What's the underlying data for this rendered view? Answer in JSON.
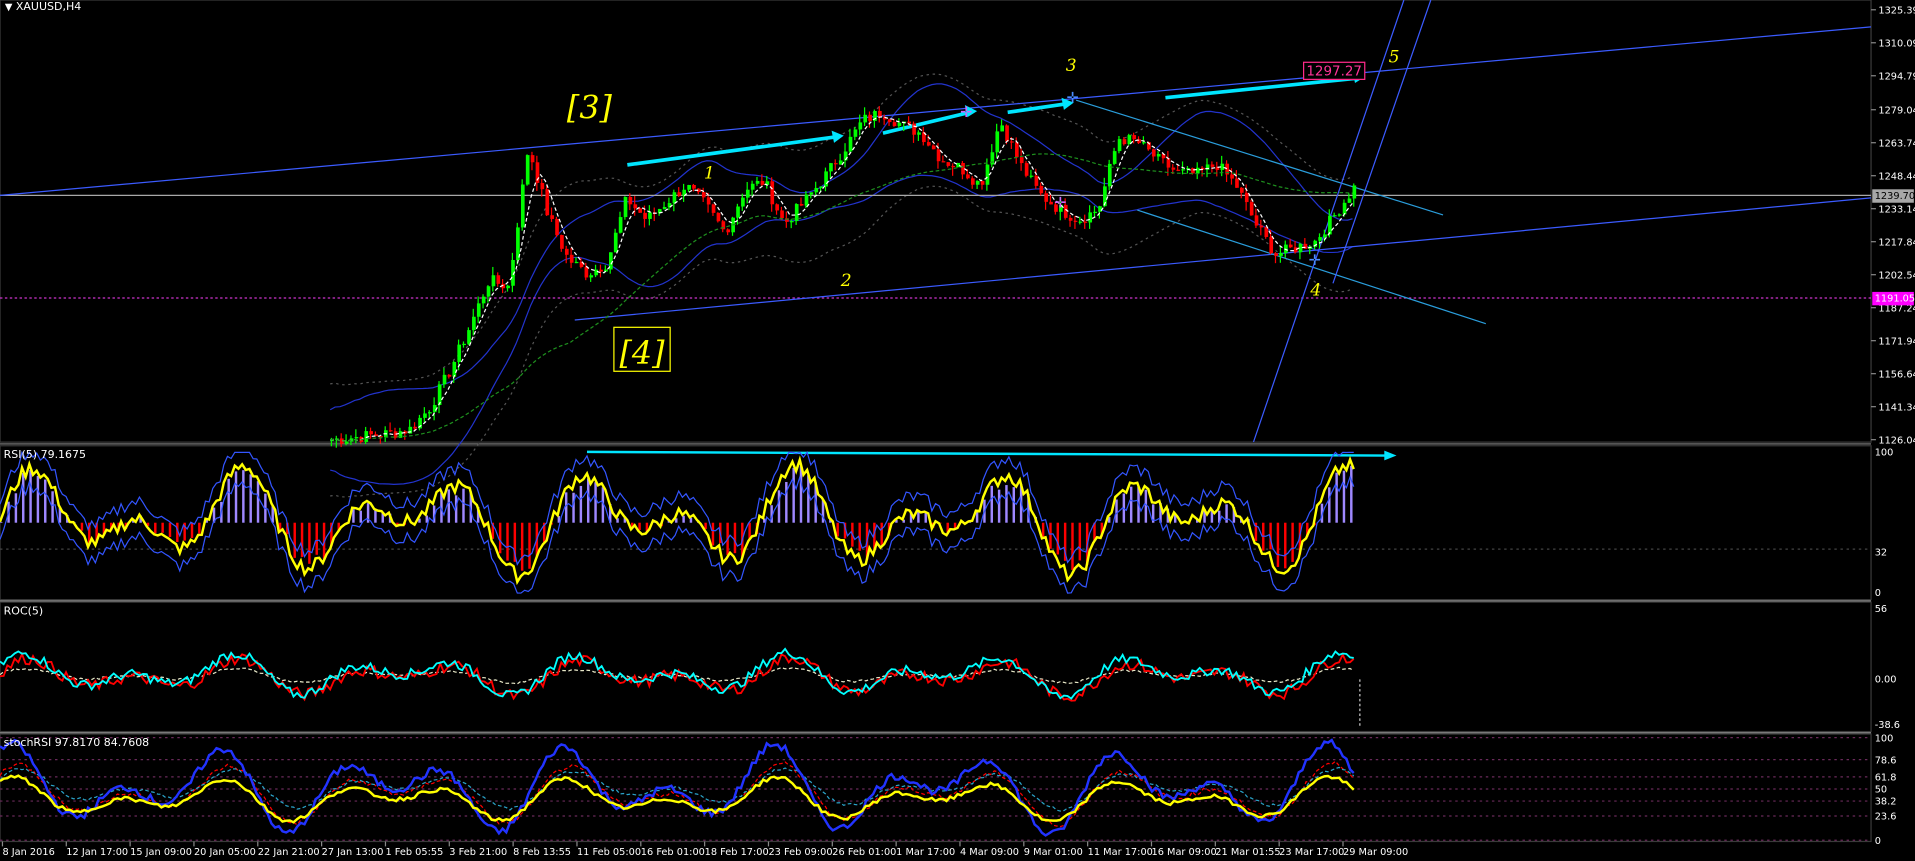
{
  "colors": {
    "bg": "#000000",
    "bull": "#00ff00",
    "bear": "#ff0000",
    "yellow": "#ffff00",
    "cyan": "#00ffff",
    "blue": "#3b5bff",
    "violet": "#9f88ff",
    "hline": "#cc33cc",
    "magenta": "#ff00ff"
  },
  "main": {
    "title": "XAUUSD,H4",
    "price_axis": [
      "1325.39",
      "1310.09",
      "1294.79",
      "1279.04",
      "1263.74",
      "1248.44",
      "1239.70",
      "1233.14",
      "1217.84",
      "1202.54",
      "1187.24",
      "1171.94",
      "1156.64",
      "1141.34",
      "1126.04"
    ],
    "current_price": "1239.70",
    "line_label": "1191.05",
    "target_label": "1297.27",
    "waves": [
      "[3]",
      "[4]",
      "1",
      "2",
      "3",
      "4",
      "5"
    ]
  },
  "rsi": {
    "title": "RSI(5) 79.1675",
    "axis": [
      "100",
      "32",
      "0"
    ]
  },
  "roc": {
    "title": "ROC(5)",
    "axis": [
      "56",
      "0.00",
      "-38.6"
    ]
  },
  "stoch": {
    "title": "stochRSI 97.8170 84.7608",
    "axis": [
      "100",
      "78.6",
      "61.8",
      "50",
      "38.2",
      "23.6",
      "0"
    ]
  },
  "time_axis": [
    "8 Jan 2016",
    "12 Jan 17:00",
    "15 Jan 09:00",
    "20 Jan 05:00",
    "22 Jan 21:00",
    "27 Jan 13:00",
    "1 Feb 05:55",
    "3 Feb 21:00",
    "8 Feb 13:55",
    "11 Feb 05:00",
    "16 Feb 01:00",
    "18 Feb 17:00",
    "23 Feb 09:00",
    "26 Feb 01:00",
    "1 Mar 17:00",
    "4 Mar 09:00",
    "9 Mar 01:00",
    "11 Mar 17:00",
    "16 Mar 09:00",
    "21 Mar 01:55",
    "23 Mar 17:00",
    "29 Mar 09:00"
  ],
  "chart_data": {
    "type": "candlestick",
    "symbol": "XAUUSD",
    "timeframe": "H4",
    "ylim": [
      1126.04,
      1325.39
    ],
    "x": [
      "8 Jan 2016",
      "12 Jan 17:00",
      "15 Jan 09:00",
      "20 Jan 05:00",
      "22 Jan 21:00",
      "27 Jan 13:00",
      "1 Feb 05:55",
      "3 Feb 21:00",
      "8 Feb 13:55",
      "11 Feb 05:00",
      "16 Feb 01:00",
      "18 Feb 17:00",
      "23 Feb 09:00",
      "26 Feb 01:00",
      "1 Mar 17:00",
      "4 Mar 09:00",
      "9 Mar 01:00",
      "11 Mar 17:00",
      "16 Mar 09:00",
      "21 Mar 01:55",
      "23 Mar 17:00",
      "29 Mar 09:00"
    ],
    "close_path": [
      1126,
      1127,
      1128,
      1129,
      1131,
      1141,
      1158,
      1178,
      1200,
      1197,
      1262,
      1230,
      1210,
      1203,
      1208,
      1238,
      1228,
      1236,
      1244,
      1235,
      1222,
      1242,
      1246,
      1226,
      1236,
      1247,
      1260,
      1274,
      1278,
      1272,
      1268,
      1256,
      1252,
      1244,
      1274,
      1254,
      1240,
      1233,
      1228,
      1233,
      1266,
      1264,
      1256,
      1250,
      1249,
      1254,
      1244,
      1226,
      1212,
      1215,
      1218,
      1230,
      1243
    ],
    "indicators": {
      "rsi": {
        "period": 5,
        "value": 79.1675,
        "levels": [
          100,
          32,
          0
        ]
      },
      "roc": {
        "period": 5,
        "levels": [
          56,
          0,
          -38.6
        ]
      },
      "stochRSI": {
        "k": 97.817,
        "d": 84.7608,
        "levels": [
          100,
          78.6,
          61.8,
          50,
          38.2,
          23.6,
          0
        ]
      }
    },
    "annotations": [
      {
        "text": "[3]",
        "price": 1261
      },
      {
        "text": "[4]",
        "price": 1185
      },
      {
        "text": "1",
        "price": 1255
      },
      {
        "text": "2",
        "price": 1203
      },
      {
        "text": "3",
        "price": 1285
      },
      {
        "text": "4",
        "price": 1205
      },
      {
        "text": "5",
        "price": 1298
      },
      {
        "text": "1297.27",
        "price": 1297.27
      }
    ],
    "horizontal_lines": [
      1239.7,
      1191.05
    ]
  }
}
